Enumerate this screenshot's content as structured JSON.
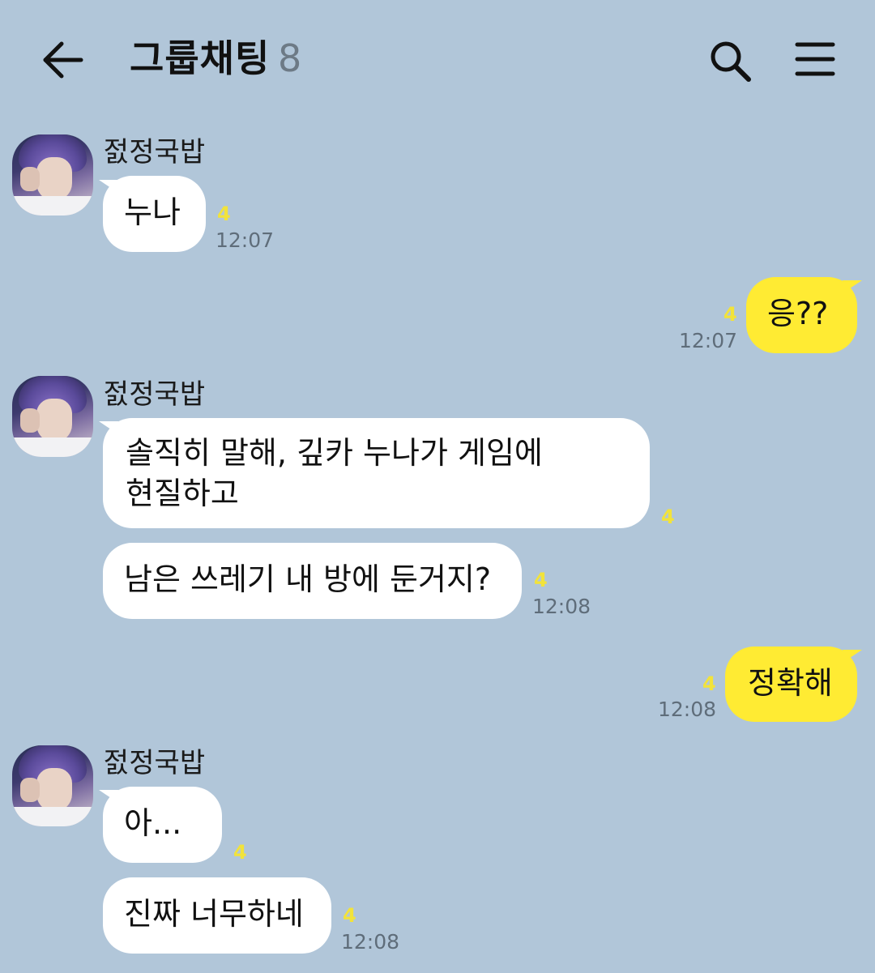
{
  "header": {
    "title": "그룹채팅",
    "member_count": "8"
  },
  "messages": [
    {
      "sender": "젌정국밥",
      "text": "누나",
      "unread": "4",
      "time": "12:07"
    },
    {
      "text": "응??",
      "unread": "4",
      "time": "12:07"
    },
    {
      "sender": "젌정국밥",
      "text_line1": "솔직히 말해, 깊카 누나가 게임에",
      "text_line2": "현질하고",
      "unread": "4"
    },
    {
      "text": "남은 쓰레기 내 방에 둔거지?",
      "unread": "4",
      "time": "12:08"
    },
    {
      "text": "정확해",
      "unread": "4",
      "time": "12:08"
    },
    {
      "sender": "젌정국밥",
      "text": "아...",
      "unread": "4"
    },
    {
      "text": "진짜 너무하네",
      "unread": "4",
      "time": "12:08"
    }
  ],
  "colors": {
    "background": "#b1c6d9",
    "my_bubble": "#ffeb33",
    "their_bubble": "#ffffff",
    "unread": "#f2e33a"
  },
  "icons": [
    "back-arrow-icon",
    "search-icon",
    "menu-icon"
  ]
}
